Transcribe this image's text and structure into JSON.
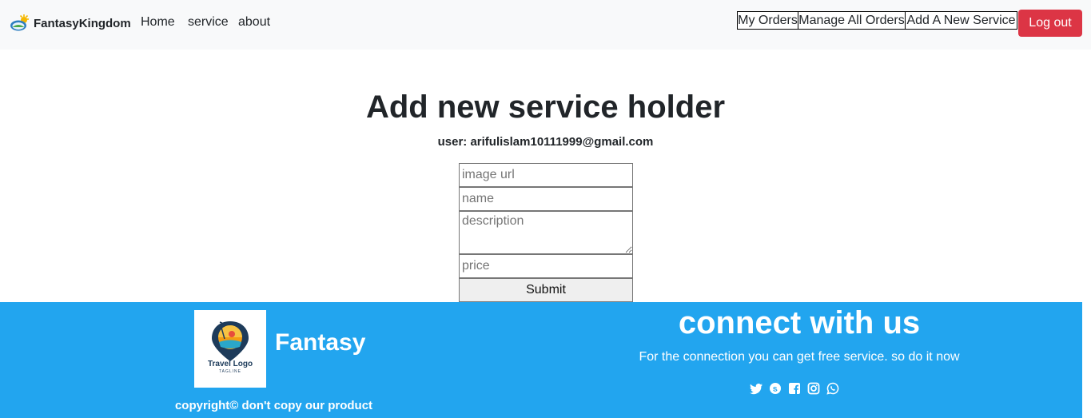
{
  "navbar": {
    "brand": "FantasyKingdom",
    "links": [
      "Home",
      "service",
      "about"
    ],
    "buttons": [
      "My Orders",
      "Manage All Orders",
      "Add A New Service"
    ],
    "logout": "Log out",
    "logout_color": "#dc3545"
  },
  "main": {
    "title": "Add new service holder",
    "user": "user: arifulislam10111999@gmail.com",
    "form": {
      "image_placeholder": "image url",
      "name_placeholder": "name",
      "description_placeholder": "description",
      "price_placeholder": "price",
      "submit": "Submit"
    }
  },
  "footer": {
    "brand": "Fantasy",
    "logo_text": "Travel Logo",
    "logo_tagline": "TAGLINE",
    "copyright": "copyright© don't copy our product",
    "connect_title": "connect with us",
    "connect_sub": "For the connection you can get free service. so do it now",
    "social_icons": [
      "twitter-icon",
      "skype-icon",
      "facebook-icon",
      "instagram-icon",
      "whatsapp-icon"
    ],
    "bg_color": "#22a5ef"
  }
}
